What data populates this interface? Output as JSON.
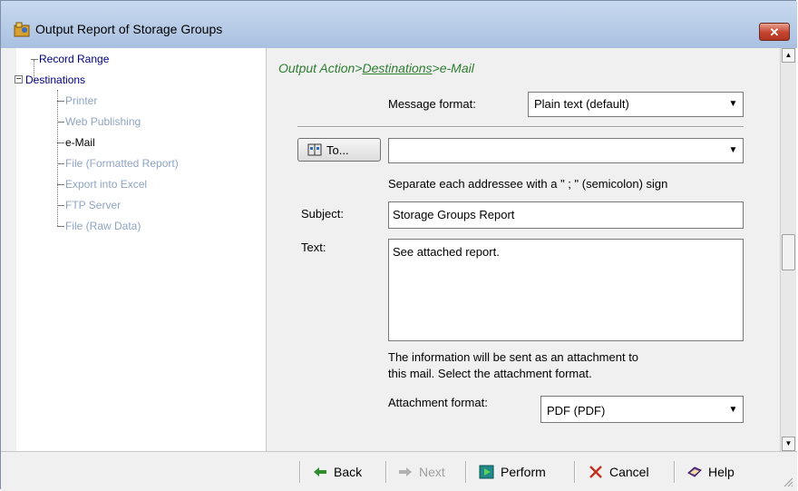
{
  "window": {
    "title": "Output Report of Storage Groups",
    "close_label": "✕"
  },
  "tree": {
    "record_range": "Record Range",
    "destinations": "Destinations",
    "expander": "−",
    "children": [
      "Printer",
      "Web Publishing",
      "e-Mail",
      "File (Formatted Report)",
      "Export into Excel",
      "FTP Server",
      "File (Raw Data)"
    ]
  },
  "content": {
    "breadcrumb": {
      "prefix": "Output Action>",
      "link": "Destinations",
      "suffix": ">e-Mail"
    },
    "message_format_label": "Message format:",
    "message_format_value": "Plain text (default)",
    "to_button_label": "To...",
    "to_value": "",
    "separator_hint": "Separate each addressee with a \" ; \" (semicolon) sign",
    "subject_label": "Subject:",
    "subject_value": "Storage Groups Report",
    "text_label": "Text:",
    "text_value": "See attached report.",
    "attachment_note_1": "The information will be sent as an attachment to",
    "attachment_note_2": "this mail. Select the attachment format.",
    "attachment_format_label": "Attachment format:",
    "attachment_format_value": "PDF (PDF)"
  },
  "toolbar": {
    "back": "Back",
    "next": "Next",
    "perform": "Perform",
    "cancel": "Cancel",
    "help": "Help"
  },
  "colors": {
    "breadcrumb": "#2e7d32",
    "tree_root": "#000080",
    "tree_child": "#8fa4c4"
  }
}
